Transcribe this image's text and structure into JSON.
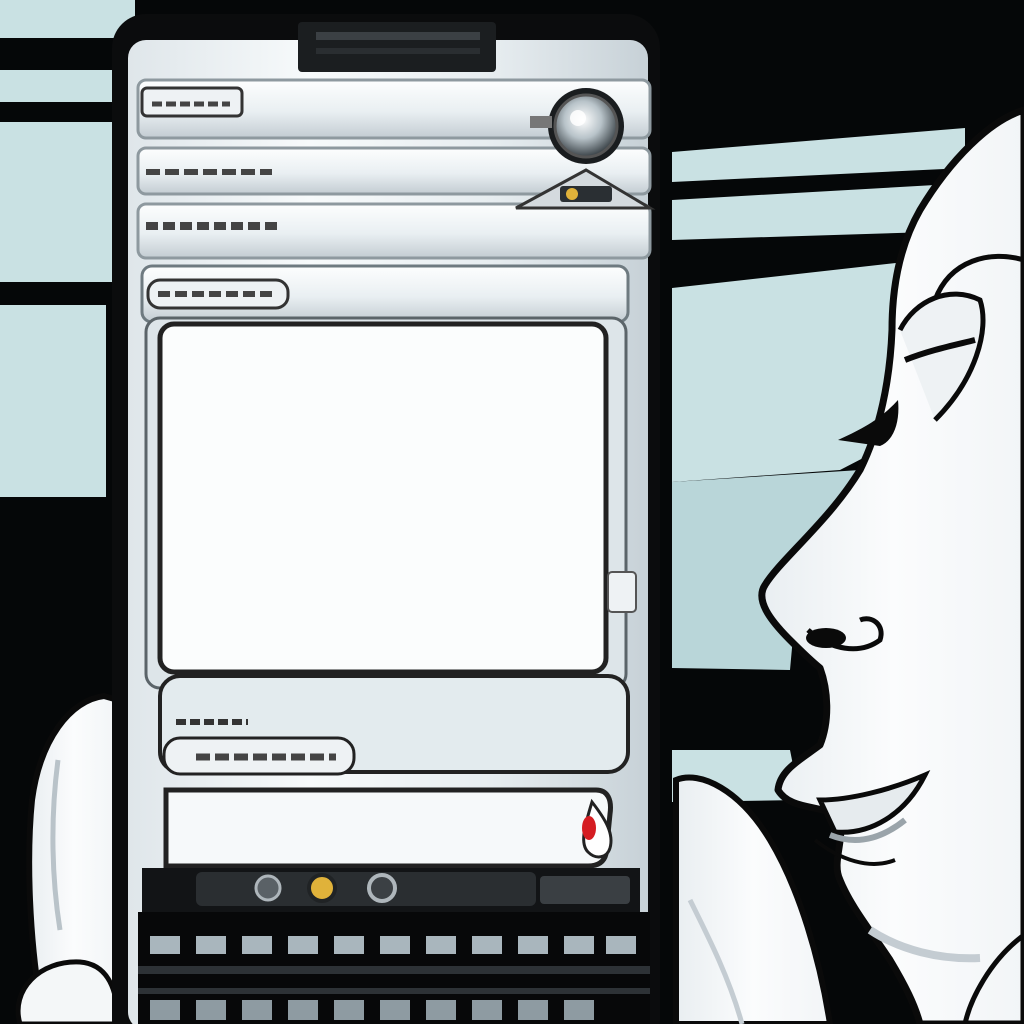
{
  "scene": {
    "description_shown": "",
    "colors": {
      "background": "#050708",
      "window_pane": "#c9e1e3",
      "window_pane_dark": "#aacfd3",
      "device_metal": "#eef3f5",
      "device_shadow": "#c8d2d8",
      "screen_white": "#fbfdfd",
      "ink": "#0a0a0a",
      "skin": "#f6f8f9",
      "skin_shade": "#d7dde2",
      "indicator_red": "#d51d22",
      "indicator_gold": "#e0b23a"
    },
    "icons": {
      "camera": "camera-lens-icon",
      "indicator": "red-indicator-icon",
      "port": "port-icon"
    }
  }
}
